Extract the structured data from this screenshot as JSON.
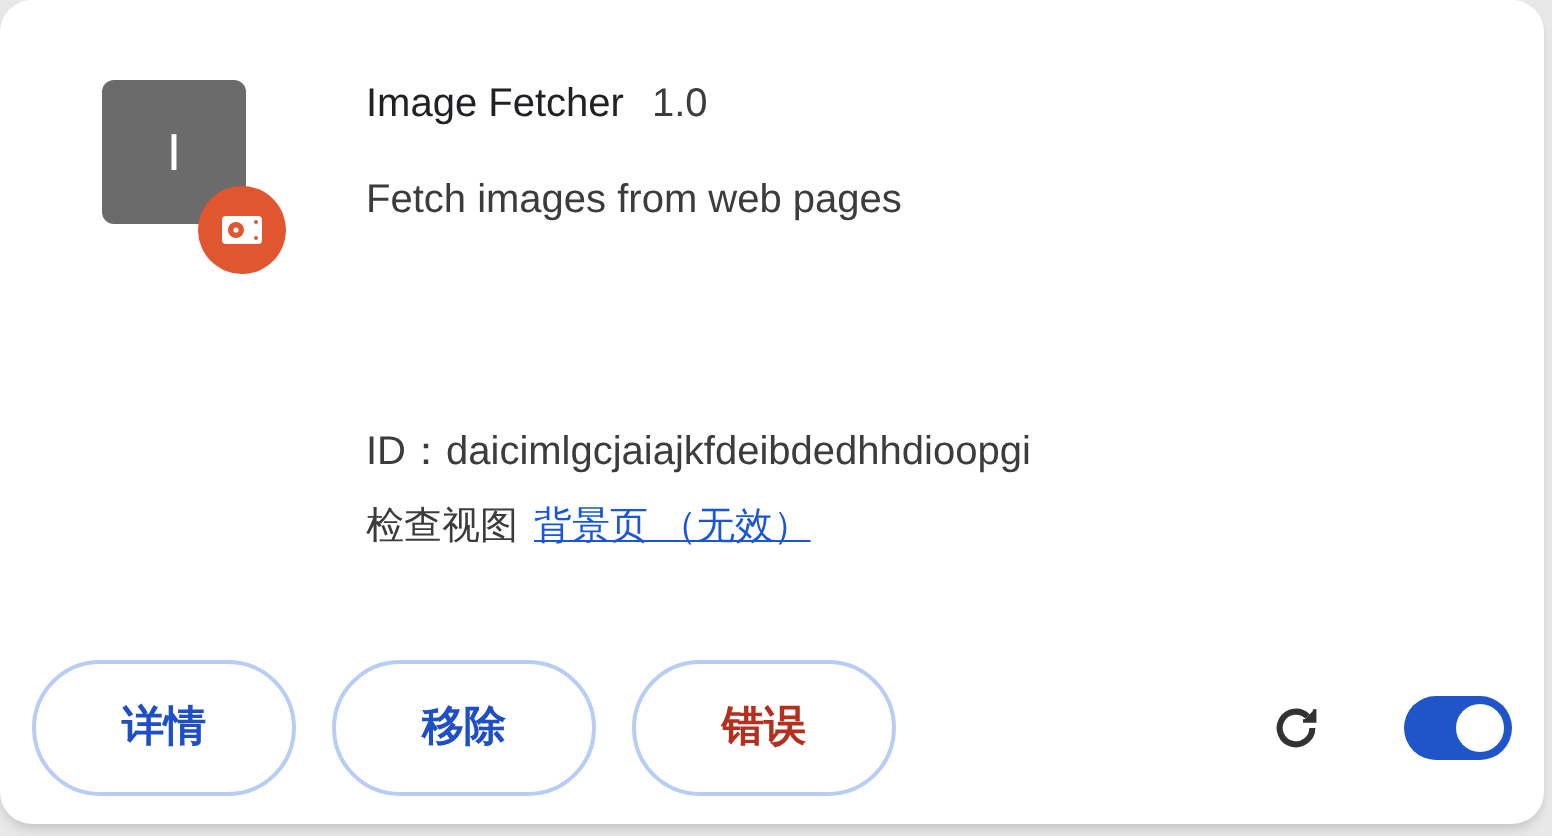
{
  "extension": {
    "icon_letter": "I",
    "name": "Image Fetcher",
    "version": "1.0",
    "description": "Fetch images from web pages",
    "id_label": "ID：",
    "id": "daicimlgcjaiajkfdeibdedhhdioopgi",
    "inspect_label": "检查视图",
    "inspect_link": "背景页 （无效）"
  },
  "buttons": [
    {
      "label": "详情",
      "kind": "normal"
    },
    {
      "label": "移除",
      "kind": "normal"
    },
    {
      "label": "错误",
      "kind": "error"
    }
  ],
  "enabled": {
    "on": true
  }
}
